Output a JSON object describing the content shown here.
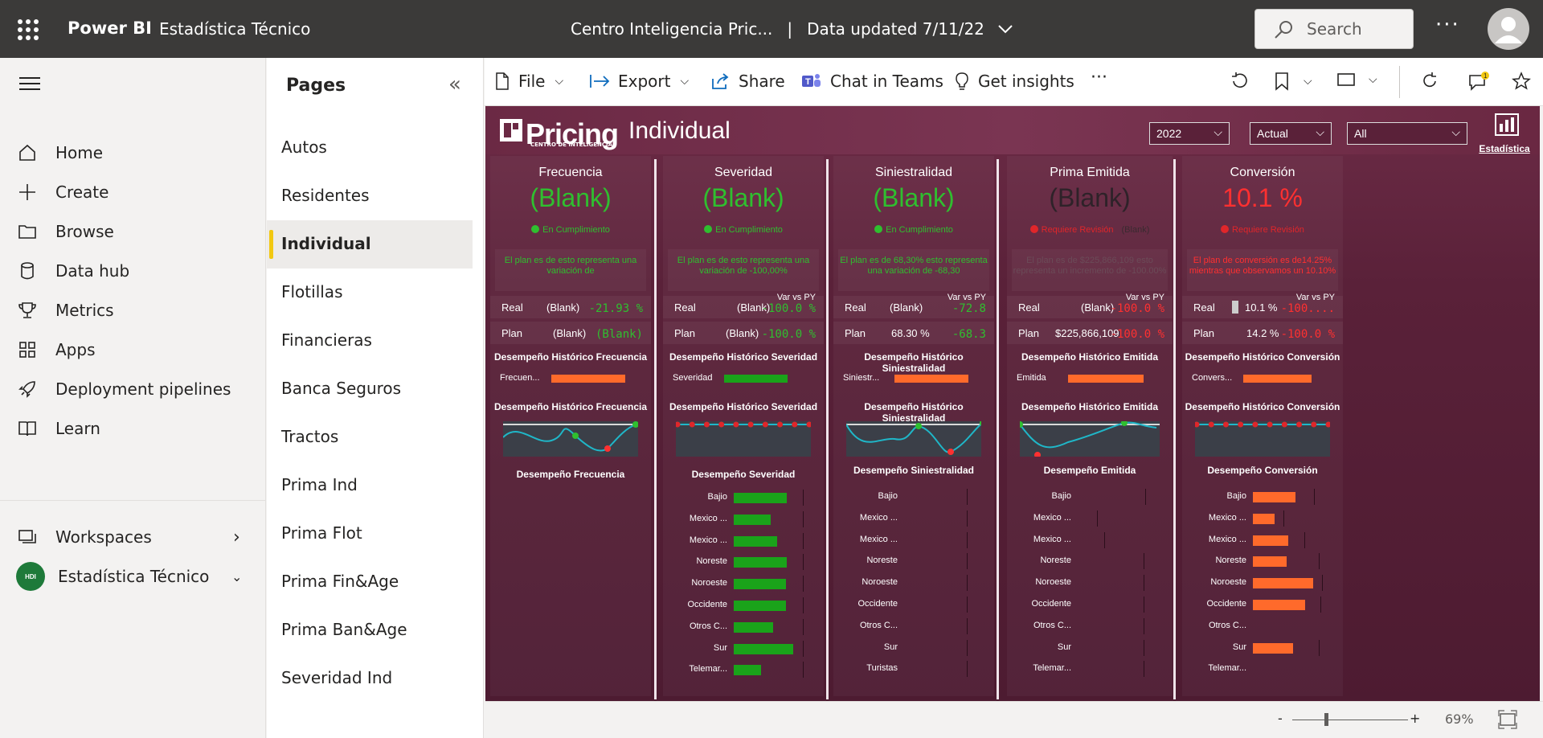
{
  "topbar": {
    "brand": "Power BI",
    "workspace": "Estadística Técnico",
    "report_title": "Centro Inteligencia Pric...",
    "separator": "|",
    "data_updated": "Data updated 7/11/22",
    "search_placeholder": "Search",
    "more": "···"
  },
  "nav": {
    "items": [
      {
        "label": "Home",
        "icon": "home-icon"
      },
      {
        "label": "Create",
        "icon": "plus-icon"
      },
      {
        "label": "Browse",
        "icon": "folder-icon"
      },
      {
        "label": "Data hub",
        "icon": "database-icon"
      },
      {
        "label": "Metrics",
        "icon": "trophy-icon"
      },
      {
        "label": "Apps",
        "icon": "apps-icon"
      },
      {
        "label": "Deployment pipelines",
        "icon": "rocket-icon"
      },
      {
        "label": "Learn",
        "icon": "book-icon"
      }
    ],
    "workspaces": "Workspaces",
    "current_workspace": "Estadística Técnico",
    "workspace_badge": "HDI"
  },
  "pages": {
    "title": "Pages",
    "items": [
      "Autos",
      "Residentes",
      "Individual",
      "Flotillas",
      "Financieras",
      "Banca Seguros",
      "Tractos",
      "Prima Ind",
      "Prima Flot",
      "Prima Fin&Age",
      "Prima Ban&Age",
      "Severidad Ind"
    ],
    "active": "Individual"
  },
  "toolbar": {
    "file": "File",
    "export": "Export",
    "share": "Share",
    "chat": "Chat in Teams",
    "insights": "Get insights",
    "more": "···",
    "notifications": "1"
  },
  "report": {
    "logo": "Pricing",
    "logo_sub": "CENTRO DE INTELIGENCIA",
    "title": "Individual",
    "slicers": {
      "year": "2022",
      "scenario": "Actual",
      "filter": "All"
    },
    "brand": "Estadística",
    "colors": {
      "green": "#2fbf2f",
      "red": "#ff3030",
      "orange": "#ff6a2b",
      "bar_green": "#1aa31a"
    },
    "kpis": [
      {
        "title": "Frecuencia",
        "value": "(Blank)",
        "status": "En Cumplimiento",
        "note": "El plan es de  esto representa una variación de",
        "real_label": "Real",
        "real": "(Blank)",
        "real_var": "-21.93 %",
        "plan_label": "Plan",
        "plan": "(Blank)",
        "plan_var": "(Blank)",
        "var_label": "",
        "hist_title": "Desempeño Histórico Frecuencia",
        "hist_bar_label": "Frecuen...",
        "trend_title": "Desempeño Histórico Frecuencia",
        "breakdown_title": "Desempeño Frecuencia"
      },
      {
        "title": "Severidad",
        "value": "(Blank)",
        "status": "En Cumplimiento",
        "note": "El plan es de  esto representa una variación de -100,00%",
        "real_label": "Real",
        "real": "(Blank)",
        "real_var": "-100.0 %",
        "plan_label": "Plan",
        "plan": "(Blank)",
        "plan_var": "-100.0 %",
        "var_label": "Var vs PY",
        "hist_title": "Desempeño Histórico Severidad",
        "hist_bar_label": "Severidad",
        "trend_title": "Desempeño Histórico Severidad",
        "breakdown_title": "Desempeño Severidad"
      },
      {
        "title": "Siniestralidad",
        "value": "(Blank)",
        "status": "En Cumplimiento",
        "note": "El plan es de 68,30% esto representa una variación de -68,30",
        "real_label": "Real",
        "real": "(Blank)",
        "real_var": "-72.8",
        "plan_label": "Plan",
        "plan": "68.30 %",
        "plan_var": "-68.3",
        "var_label": "Var vs PY",
        "hist_title": "Desempeño Histórico Siniestralidad",
        "hist_bar_label": "Siniestr...",
        "trend_title": "Desempeño Histórico Siniestralidad",
        "breakdown_title": "Desempeño Siniestralidad"
      },
      {
        "title": "Prima Emitida",
        "value": "(Blank)",
        "status": "Requiere Revisión",
        "status_extra": "(Blank)",
        "note": "El plan es de $225,866,109 esto representa un incremento de -100.00%",
        "real_label": "Real",
        "real": "(Blank)",
        "real_var": "-100.0 %",
        "plan_label": "Plan",
        "plan": "$225,866,109",
        "plan_var": "-100.0 %",
        "var_label": "Var vs PY",
        "hist_title": "Desempeño Histórico Emitida",
        "hist_bar_label": "Emitida",
        "trend_title": "Desempeño Histórico Emitida",
        "breakdown_title": "Desempeño Emitida"
      },
      {
        "title": "Conversión",
        "value": "10.1 %",
        "status": "Requiere Revisión",
        "note": "El plan de conversión es de14.25% mientras que observamos un 10.10%",
        "real_label": "Real",
        "real": "10.1 %",
        "real_var": "-100....",
        "plan_label": "Plan",
        "plan": "14.2 %",
        "plan_var": "-100.0 %",
        "var_label": "Var vs PY",
        "hist_title": "Desempeño Histórico Conversión",
        "hist_bar_label": "Convers...",
        "trend_title": "Desempeño Histórico Conversión",
        "breakdown_title": "Desempeño Conversión"
      }
    ],
    "breakdowns": [
      {
        "categories": [],
        "values": []
      },
      {
        "categories": [
          "Bajio",
          "Mexico ...",
          "Mexico ...",
          "Noreste",
          "Noroeste",
          "Occidente",
          "Otros C...",
          "Sur",
          "Telemar..."
        ],
        "values": [
          0.82,
          0.58,
          0.68,
          0.82,
          0.81,
          0.81,
          0.61,
          0.92,
          0.43
        ]
      },
      {
        "categories": [
          "Bajio",
          "Mexico ...",
          "Mexico ...",
          "Noreste",
          "Noroeste",
          "Occidente",
          "Otros C...",
          "Sur",
          "Turistas"
        ],
        "values": [
          0,
          0,
          0,
          0,
          0,
          0,
          0,
          0,
          0
        ]
      },
      {
        "categories": [
          "Bajio",
          "Mexico ...",
          "Mexico ...",
          "Noreste",
          "Noroeste",
          "Occidente",
          "Otros C...",
          "Sur",
          "Telemar..."
        ],
        "values": [
          0,
          0,
          0,
          0,
          0,
          0,
          0,
          0,
          0
        ]
      },
      {
        "categories": [
          "Bajio",
          "Mexico ...",
          "Mexico ...",
          "Noreste",
          "Noroeste",
          "Occidente",
          "Otros C...",
          "Sur",
          "Telemar..."
        ],
        "values": [
          0.66,
          0.34,
          0.55,
          0.53,
          0.94,
          0.81,
          0,
          0.63,
          0
        ]
      }
    ],
    "hist_bar_values": [
      0.88,
      0.76,
      0.88,
      0.85,
      0.82
    ]
  },
  "bottom": {
    "zoom_minus": "-",
    "zoom_plus": "+",
    "zoom": "69%"
  }
}
